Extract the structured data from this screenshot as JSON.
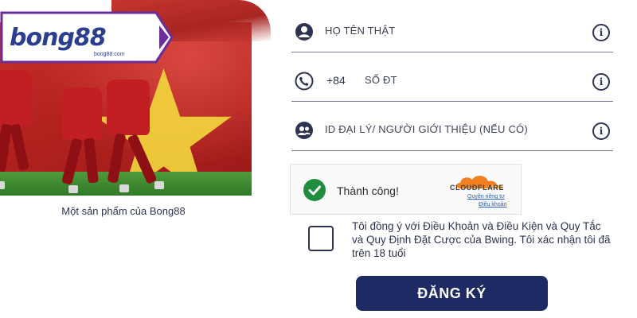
{
  "brand": {
    "logo_text": "bong88",
    "logo_subtext": "bong88.com",
    "tagline": "Một sản phẩm của Bong88"
  },
  "form": {
    "fields": [
      {
        "label": "HỌ TÊN THẬT",
        "icon": "user-icon"
      },
      {
        "prefix": "+84",
        "label": "SỐ ĐT",
        "icon": "phone-icon"
      },
      {
        "label": "ID ĐẠI LÝ/ NGƯỜI GIỚI THIỆU (NẾU CÓ)",
        "icon": "referral-icon"
      }
    ],
    "info_glyph": "i",
    "captcha": {
      "status": "Thành công!",
      "provider": "CLOUDFLARE",
      "privacy_link": "Quyền riêng tư",
      "terms_link": "Điều khoản"
    },
    "agreement": "Tôi đồng ý với Điều Khoản và Điều Kiện và Quy Tắc và Quy Định Đặt Cược của Bwing. Tôi xác nhận tôi đã trên 18 tuổi",
    "agreement_checked": false,
    "submit_label": "ĐĂNG KÝ"
  },
  "colors": {
    "primary": "#1e2a63",
    "success": "#1e8e3e",
    "flag_red": "#c9302c",
    "flag_star": "#f2d53c",
    "cloudflare_orange": "#f38020"
  }
}
